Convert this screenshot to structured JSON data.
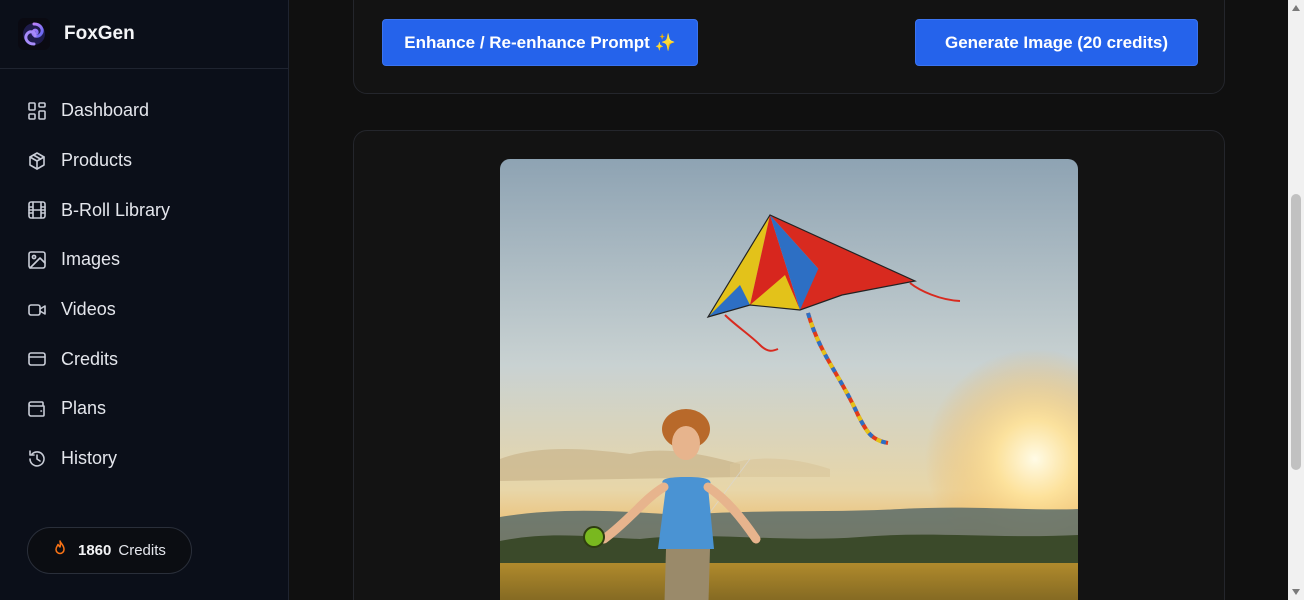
{
  "app": {
    "name": "FoxGen"
  },
  "sidebar": {
    "items": [
      {
        "label": "Dashboard",
        "icon": "dashboard-icon"
      },
      {
        "label": "Products",
        "icon": "box-icon"
      },
      {
        "label": "B-Roll Library",
        "icon": "film-icon"
      },
      {
        "label": "Images",
        "icon": "image-icon"
      },
      {
        "label": "Videos",
        "icon": "video-icon"
      },
      {
        "label": "Credits",
        "icon": "credit-card-icon"
      },
      {
        "label": "Plans",
        "icon": "wallet-icon"
      },
      {
        "label": "History",
        "icon": "history-icon"
      }
    ],
    "credits": {
      "amount": "1860",
      "label": "Credits",
      "icon": "flame-icon",
      "icon_color": "#f97316"
    }
  },
  "toolbar": {
    "enhance_label": "Enhance / Re-enhance Prompt ✨",
    "generate_label": "Generate Image (20 credits)"
  },
  "colors": {
    "accent": "#2563eb",
    "sidebar_bg": "#0b0f19",
    "main_bg": "#101010"
  }
}
